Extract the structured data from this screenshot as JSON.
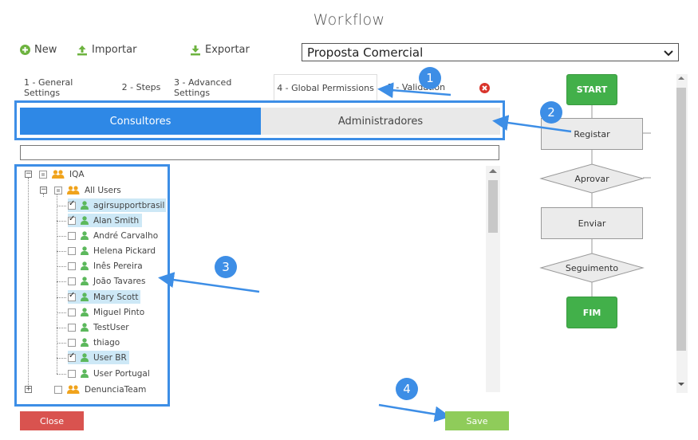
{
  "window": {
    "title": "Workflow"
  },
  "toolbar": {
    "new_label": "New",
    "import_label": "Importar",
    "export_label": "Exportar"
  },
  "workflow_select": {
    "value": "Proposta Comercial"
  },
  "tabs": [
    {
      "label": "1 - General Settings"
    },
    {
      "label": "2 - Steps"
    },
    {
      "label": "3 - Advanced Settings"
    },
    {
      "label": "4 - Global Permissions"
    },
    {
      "label": "5 - Validation"
    }
  ],
  "segments": {
    "left": "Consultores",
    "right": "Administradores"
  },
  "tree": {
    "root": "IQA",
    "group": "All Users",
    "users": [
      {
        "name": "agirsupportbrasil",
        "checked": true
      },
      {
        "name": "Alan Smith",
        "checked": true
      },
      {
        "name": "André Carvalho",
        "checked": false
      },
      {
        "name": "Helena Pickard",
        "checked": false
      },
      {
        "name": "Inês Pereira",
        "checked": false
      },
      {
        "name": "João Tavares",
        "checked": false
      },
      {
        "name": "Mary Scott",
        "checked": true
      },
      {
        "name": "Miguel Pinto",
        "checked": false
      },
      {
        "name": "TestUser",
        "checked": false
      },
      {
        "name": "thiago",
        "checked": false
      },
      {
        "name": "User BR",
        "checked": true
      },
      {
        "name": "User Portugal",
        "checked": false
      }
    ],
    "other_group": "DenunciaTeam"
  },
  "flow": {
    "start": "START",
    "step1": "Registar",
    "decision1": "Aprovar",
    "step2": "Enviar",
    "decision2": "Seguimento",
    "end": "FIM"
  },
  "badges": [
    "1",
    "2",
    "3",
    "4"
  ],
  "buttons": {
    "close": "Close",
    "save": "Save"
  },
  "colors": {
    "accent": "#3d8ee6",
    "green": "#42b04a",
    "close": "#d9534f",
    "save": "#8fcc5a"
  }
}
